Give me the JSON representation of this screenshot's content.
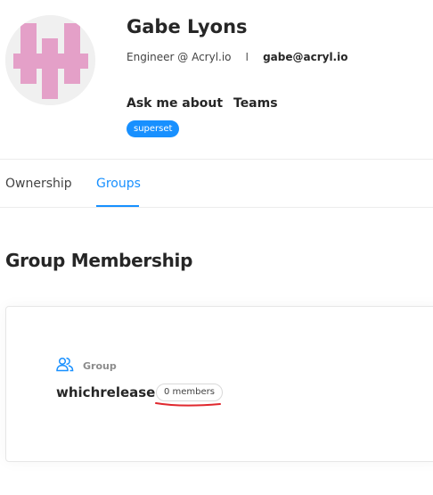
{
  "profile": {
    "name": "Gabe Lyons",
    "title": "Engineer @ Acryl.io",
    "separator": "I",
    "email": "gabe@acryl.io",
    "ask_me_about_label": "Ask me about",
    "teams_label": "Teams",
    "tags": [
      "superset"
    ],
    "avatar_color": "#e4a0c8"
  },
  "tabs": [
    {
      "label": "Ownership",
      "active": false
    },
    {
      "label": "Groups",
      "active": true
    }
  ],
  "section": {
    "title": "Group Membership"
  },
  "groups": [
    {
      "type_label": "Group",
      "type_icon": "users-icon",
      "name": "whichrelease",
      "members": "0 members"
    }
  ],
  "colors": {
    "accent": "#1890ff",
    "annotation": "#e0282e"
  }
}
